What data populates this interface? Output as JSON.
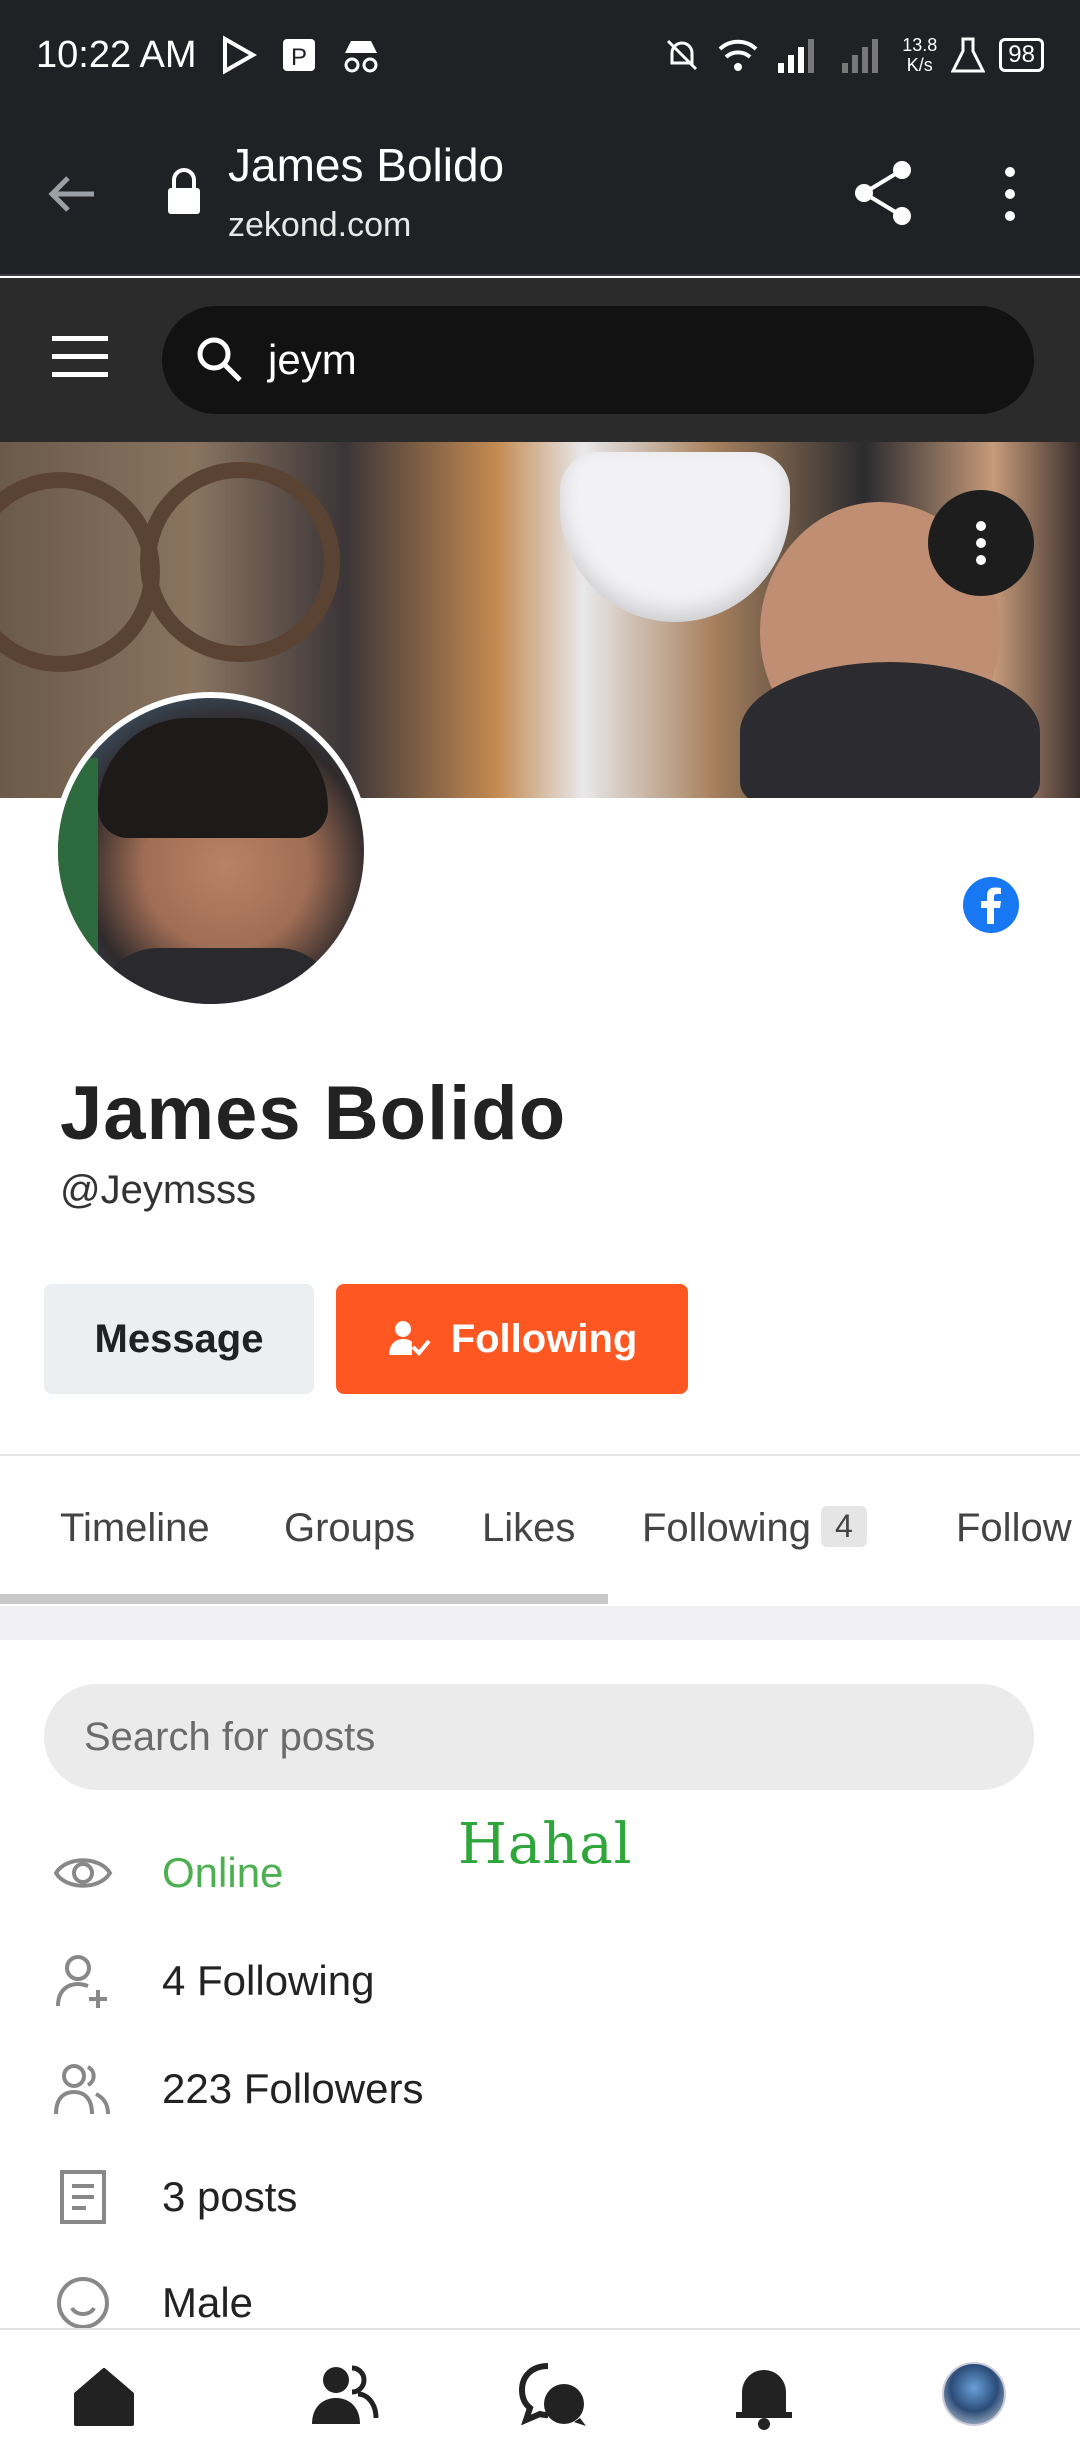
{
  "status_bar": {
    "time": "10:22 AM",
    "net_speed_value": "13.8",
    "net_speed_unit": "K/s",
    "battery": "98"
  },
  "browser": {
    "title": "James Bolido",
    "domain": "zekond.com"
  },
  "site_header": {
    "search_value": "jeym"
  },
  "profile": {
    "name": "James Bolido",
    "handle": "@Jeymsss",
    "message_label": "Message",
    "following_label": "Following"
  },
  "tabs": [
    {
      "label": "Timeline"
    },
    {
      "label": "Groups"
    },
    {
      "label": "Likes"
    },
    {
      "label": "Following",
      "count": "4"
    },
    {
      "label": "Follow"
    }
  ],
  "posts_search": {
    "placeholder": "Search for posts"
  },
  "annotation": "Hahal",
  "info": [
    {
      "icon": "eye-icon",
      "text": "Online"
    },
    {
      "icon": "user-plus-icon",
      "text": "4 Following"
    },
    {
      "icon": "users-icon",
      "text": "223 Followers"
    },
    {
      "icon": "document-icon",
      "text": "3 posts"
    },
    {
      "icon": "smile-icon",
      "text": "Male"
    }
  ],
  "colors": {
    "accent": "#ff5722",
    "online": "#4caf50",
    "facebook": "#1877f2",
    "dark_bar": "#202124"
  }
}
